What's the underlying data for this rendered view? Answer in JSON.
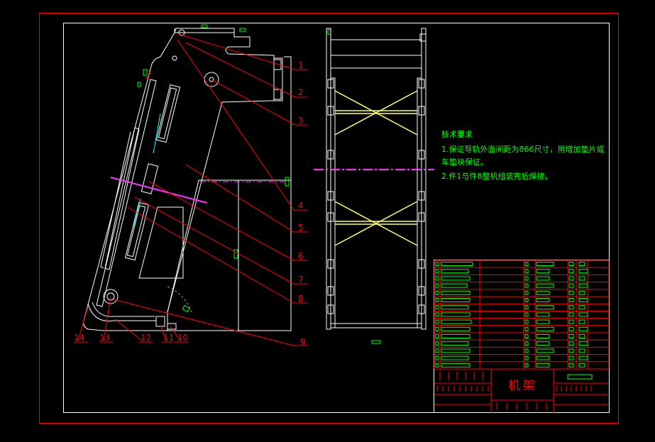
{
  "drawing_title": "机架",
  "tech_requirements": {
    "heading": "技术要求",
    "lines": [
      "1.保证导轨外面间距为866尺寸，用增加垫片或",
      "车垫块保证。",
      "2.件1与件8整机组装完后焊接。"
    ]
  },
  "callouts": {
    "right": [
      "1",
      "2",
      "3",
      "4",
      "5",
      "6",
      "7",
      "8",
      "9"
    ],
    "bottom": [
      "14",
      "13",
      "12",
      "11",
      "10"
    ]
  },
  "colors": {
    "background": "#000000",
    "outer_frame": "#ff0000",
    "inner_frame": "#ffffff",
    "leader": "#ff0000",
    "text": "#ff0000",
    "tech_text": "#00ff00",
    "brace": "#ffff66",
    "centerline": "#ff33ff",
    "marker": "#00ff00",
    "table_grid": "#ff0000",
    "table_fill": "#00ff00",
    "gray": "#a0a0a0"
  }
}
